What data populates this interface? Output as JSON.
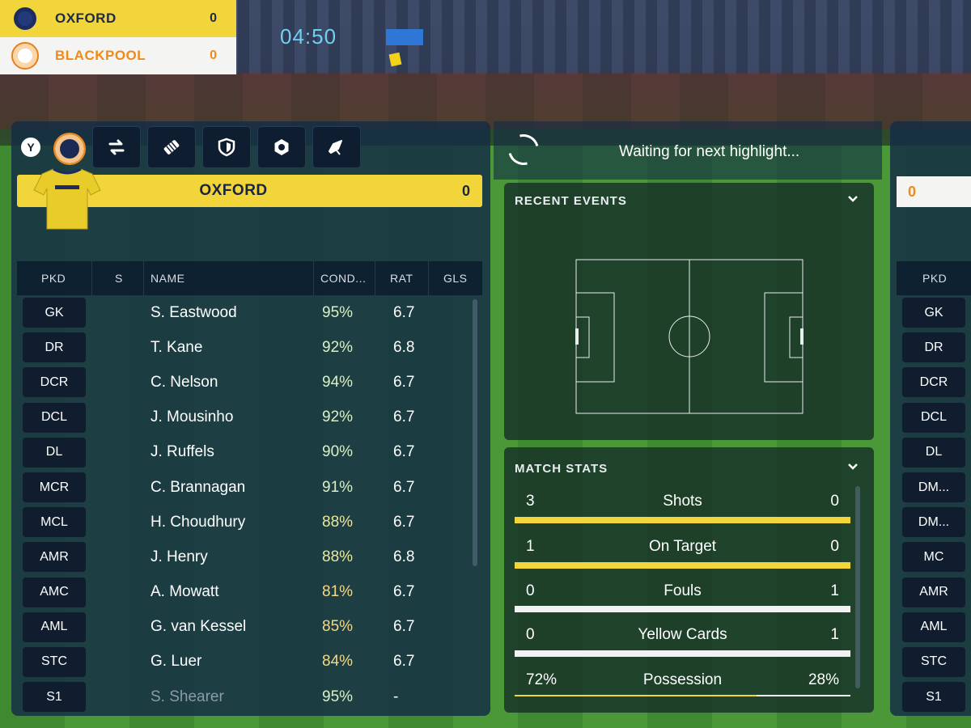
{
  "scoreboard": {
    "home": {
      "name": "OXFORD",
      "score": "0"
    },
    "away": {
      "name": "BLACKPOOL",
      "score": "0"
    },
    "clock": "04:50"
  },
  "left_panel": {
    "badge": "Y",
    "team_bar": {
      "name": "OXFORD",
      "score": "0"
    },
    "columns": [
      "PKD",
      "S",
      "NAME",
      "COND...",
      "RAT",
      "GLS"
    ],
    "players": [
      {
        "pos": "GK",
        "name": "S. Eastwood",
        "cond": "95%",
        "rat": "6.7"
      },
      {
        "pos": "DR",
        "name": "T. Kane",
        "cond": "92%",
        "rat": "6.8"
      },
      {
        "pos": "DCR",
        "name": "C. Nelson",
        "cond": "94%",
        "rat": "6.7"
      },
      {
        "pos": "DCL",
        "name": "J. Mousinho",
        "cond": "92%",
        "rat": "6.7"
      },
      {
        "pos": "DL",
        "name": "J. Ruffels",
        "cond": "90%",
        "rat": "6.7"
      },
      {
        "pos": "MCR",
        "name": "C. Brannagan",
        "cond": "91%",
        "rat": "6.7"
      },
      {
        "pos": "MCL",
        "name": "H. Choudhury",
        "cond": "88%",
        "rat": "6.7"
      },
      {
        "pos": "AMR",
        "name": "J. Henry",
        "cond": "88%",
        "rat": "6.8"
      },
      {
        "pos": "AMC",
        "name": "A. Mowatt",
        "cond": "81%",
        "rat": "6.7"
      },
      {
        "pos": "AML",
        "name": "G. van Kessel",
        "cond": "85%",
        "rat": "6.7"
      },
      {
        "pos": "STC",
        "name": "G. Luer",
        "cond": "84%",
        "rat": "6.7"
      },
      {
        "pos": "S1",
        "name": "S. Shearer",
        "cond": "95%",
        "rat": "-"
      }
    ]
  },
  "middle": {
    "waiting_text": "Waiting for next highlight...",
    "recent_events_title": "RECENT EVENTS",
    "match_stats_title": "MATCH STATS",
    "stats": [
      {
        "label": "Shots",
        "home": "3",
        "away": "0"
      },
      {
        "label": "On Target",
        "home": "1",
        "away": "0"
      },
      {
        "label": "Fouls",
        "home": "0",
        "away": "1"
      },
      {
        "label": "Yellow Cards",
        "home": "0",
        "away": "1"
      },
      {
        "label": "Possession",
        "home": "72%",
        "away": "28%"
      }
    ]
  },
  "right_panel": {
    "score": "0",
    "column": "PKD",
    "positions": [
      "GK",
      "DR",
      "DCR",
      "DCL",
      "DL",
      "DM...",
      "DM...",
      "MC",
      "AMR",
      "AML",
      "STC",
      "S1"
    ]
  },
  "colors": {
    "home_yellow": "#f1d53a",
    "away_orange": "#f08a1a",
    "clock_blue": "#6fd0f0",
    "cond_high": "#d8f0c8",
    "cond_mid": "#e9e7a0",
    "cond_low": "#f2d98a"
  }
}
